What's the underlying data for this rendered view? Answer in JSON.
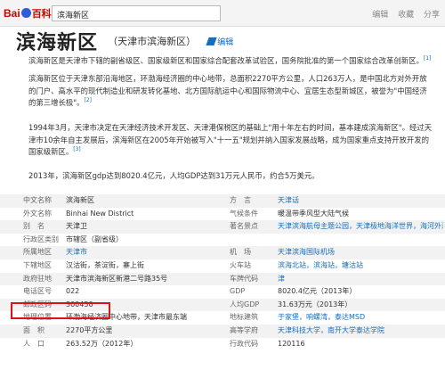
{
  "toolbar": {
    "logo_bai": "Bai",
    "logo_baike": "百科",
    "search_value": "滨海新区",
    "actions": [
      "编辑",
      "收藏",
      "分享"
    ]
  },
  "header": {
    "title": "滨海新区",
    "subtitle": "（天津市滨海新区）",
    "edit_label": "编辑"
  },
  "paragraphs": {
    "p1": "滨海新区是天津市下辖的副省级区、国家级新区和国家综合配套改革试验区，国务院批准的第一个国家综合改革创新区。",
    "p1_cite": "[1]",
    "p2": "滨海新区位于天津东部沿海地区，环渤海经济圈的中心地带，总面积2270平方公里，人口263万人，是中国北方对外开放的门户、高水平的现代制造业和研发转化基地、北方国际航运中心和国际物流中心、宜居生态型新城区，被誉为\"中国经济的第三增长极\"。",
    "p2_cite": "[2]",
    "p3": "1994年3月，天津市决定在天津经济技术开发区、天津港保税区的基础上\"用十年左右的时间，基本建成滨海新区\"。经过天津市10余年自主发展后，滨海新区在2005年开始被写入\"十一五\"规划并纳入国家发展战略，成为国家重点支持开放开发的国家级新区。",
    "p3_cite": "[3]",
    "p4": "2013年，滨海新区gdp达到8020.4亿元，人均GDP达到31万元人民币，约合5万美元。"
  },
  "info_table": [
    {
      "k1": "中文名称",
      "v1": "滨海新区",
      "k2": "方　言",
      "v2": "天津话",
      "v2_link": true
    },
    {
      "k1": "外文名称",
      "v1": "Binhai New District",
      "k2": "气候条件",
      "v2": "暖温带季风型大陆气候",
      "v2_link": false
    },
    {
      "k1": "别　名",
      "v1": "天津卫",
      "k2": "著名景点",
      "v2": "天津滨海航母主题公园，天津极地海洋世界，海河外滩公园",
      "v2_link": true
    },
    {
      "k1": "行政区类别",
      "v1": "市辖区（副省级）",
      "k2": "",
      "v2": "",
      "v2_link": false
    },
    {
      "k1": "所属地区",
      "v1": "天津市",
      "k2": "机　场",
      "v2": "天津滨海国际机场",
      "v2_link": true
    },
    {
      "k1": "下辖地区",
      "v1": "汉沽街，茶淀街，寨上街",
      "k2": "火车站",
      "v2": "滨海北站，滨海站，塘沽站",
      "v2_link": true
    },
    {
      "k1": "政府驻地",
      "v1": "天津市滨海新区新港二号路35号",
      "k2": "车牌代码",
      "v2": "津",
      "v2_link": true
    },
    {
      "k1": "电话区号",
      "v1": "022",
      "k2": "GDP",
      "v2": "8020.4亿元（2013年）",
      "v2_link": false
    },
    {
      "k1": "邮政区码",
      "v1": "300450",
      "k2": "人均GDP",
      "v2": "31.63万元（2013年）",
      "v2_link": false
    },
    {
      "k1": "地理位置",
      "v1": "环渤海经济圈中心地带，天津市最东端",
      "k2": "地标建筑",
      "v2": "于家堡，响螺湾，泰达MSD",
      "v2_link": true
    },
    {
      "k1": "面　积",
      "v1": "2270平方公里",
      "k2": "高等学府",
      "v2": "天津科技大学，南开大学泰达学院",
      "v2_link": true
    },
    {
      "k1": "人　口",
      "v1": "263.52万（2012年）",
      "k2": "行政代码",
      "v2": "120116",
      "v2_link": false
    }
  ]
}
